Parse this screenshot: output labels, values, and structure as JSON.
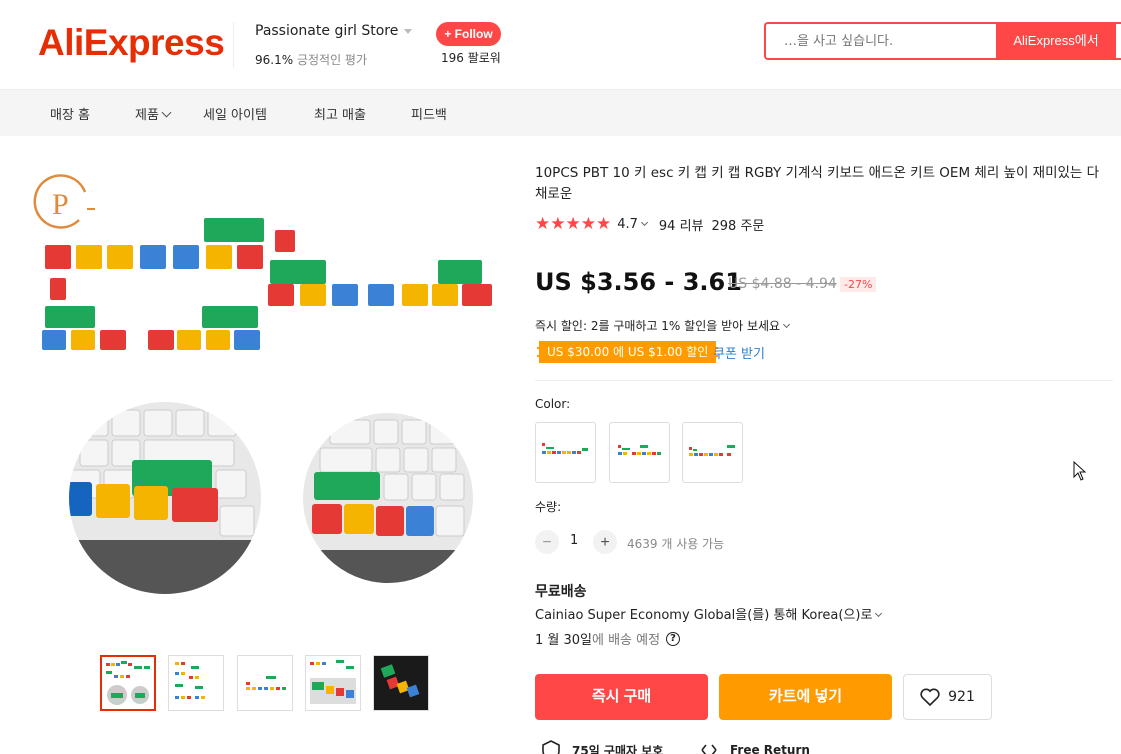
{
  "header": {
    "logo_text": "AliExpress",
    "store_name": "Passionate girl Store",
    "store_rating_value": "96.1%",
    "store_rating_label": "긍정적인 평가",
    "follow_label": "+ Follow",
    "followers": "196 팔로워",
    "search_placeholder": "…을 사고 싶습니다.",
    "search_button": "AliExpress에서"
  },
  "nav": {
    "items": [
      "매장 홈",
      "제품",
      "세일 아이템",
      "최고 매출",
      "피드백"
    ]
  },
  "product": {
    "title": "10PCS PBT 10 키 esc 키 캡 키 캡 RGBY 기계식 키보드 애드온 키트 OEM 체리 높이 재미있는 다채로운",
    "rating": "4.7",
    "reviews": "94 리뷰",
    "orders": "298 주문",
    "price": "US $3.56 - 3.61",
    "original_price": "US $4.88 - 4.94",
    "discount": "-27%",
    "instant_discount": "즉시 할인: 2를 구매하고 1% 할인을 받아 보세요",
    "coupon": "US $30.00 에 US $1.00 할인",
    "coupon_get": "쿠폰 받기",
    "color_label": "Color:",
    "quantity_label": "수량:",
    "quantity_value": "1",
    "quantity_minus": "−",
    "quantity_plus": "+",
    "available": "4639 개 사용 가능",
    "shipping_title": "무료배송",
    "shipping_via": "Cainiao Super Economy Global을(를) 통해 Korea(으)로",
    "delivery_date": "1 월 30일",
    "delivery_suffix": "에 배송 예정",
    "help_glyph": "?",
    "buy_now": "즉시 구매",
    "add_to_cart": "카트에 넣기",
    "wishlist_count": "921",
    "protection_1": "75일 구매자 보호",
    "protection_2": "Free Return"
  },
  "colors": {
    "accent": "#ff4747",
    "orange": "#ff9a00",
    "link": "#2c7fd4"
  }
}
